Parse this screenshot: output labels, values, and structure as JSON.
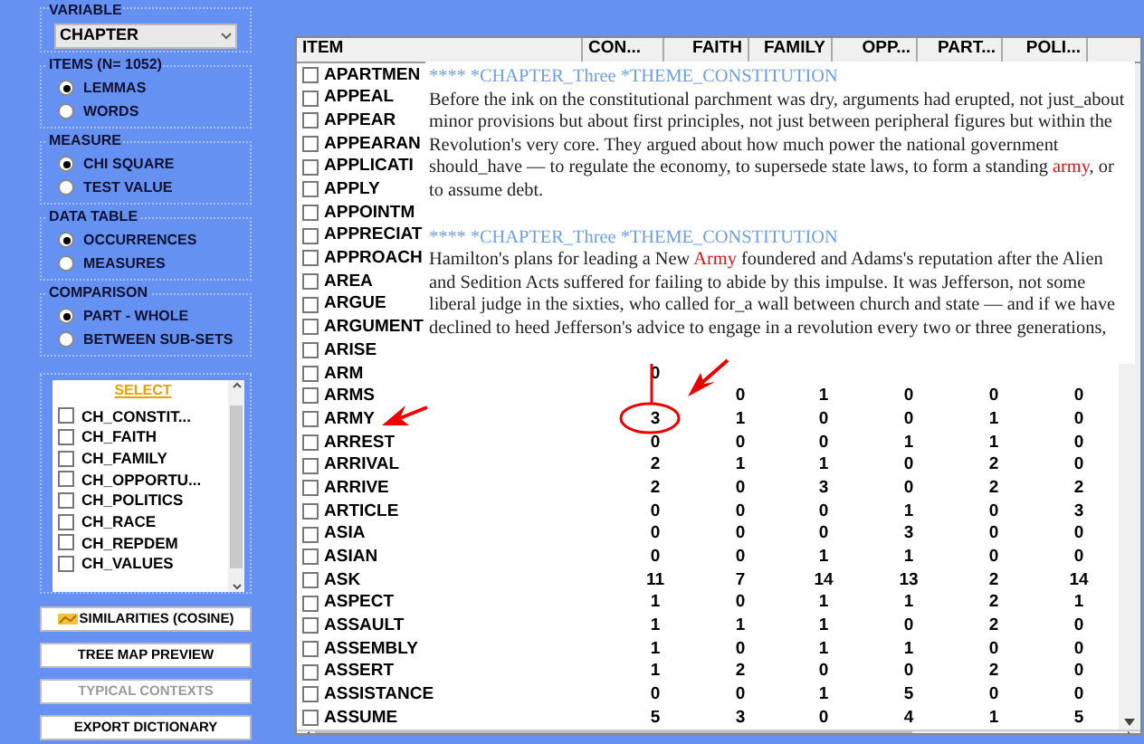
{
  "variable": {
    "label": "VARIABLE",
    "value": "CHAPTER"
  },
  "option_groups": [
    {
      "title": "ITEMS (N= 1052)",
      "options": [
        {
          "label": "LEMMAS",
          "selected": true
        },
        {
          "label": "WORDS",
          "selected": false
        }
      ]
    },
    {
      "title": "MEASURE",
      "options": [
        {
          "label": "CHI SQUARE",
          "selected": true
        },
        {
          "label": "TEST VALUE",
          "selected": false
        }
      ]
    },
    {
      "title": "DATA TABLE",
      "options": [
        {
          "label": "OCCURRENCES",
          "selected": true
        },
        {
          "label": "MEASURES",
          "selected": false
        }
      ]
    },
    {
      "title": "COMPARISON",
      "options": [
        {
          "label": "PART - WHOLE",
          "selected": true
        },
        {
          "label": "BETWEEN SUB-SETS",
          "selected": false
        }
      ]
    }
  ],
  "select_list": {
    "title": "SELECT",
    "items": [
      {
        "label": "CH_CONSTIT...",
        "checked": false
      },
      {
        "label": "CH_FAITH",
        "checked": false
      },
      {
        "label": "CH_FAMILY",
        "checked": false
      },
      {
        "label": "CH_OPPORTU...",
        "checked": false
      },
      {
        "label": "CH_POLITICS",
        "checked": false
      },
      {
        "label": "CH_RACE",
        "checked": false
      },
      {
        "label": "CH_REPDEM",
        "checked": false
      },
      {
        "label": "CH_VALUES",
        "checked": false
      }
    ]
  },
  "buttons": [
    {
      "label": "SIMILARITIES (COSINE)",
      "disabled": false,
      "icon": true
    },
    {
      "label": "TREE MAP PREVIEW",
      "disabled": false,
      "icon": false
    },
    {
      "label": "TYPICAL CONTEXTS",
      "disabled": true,
      "icon": false
    },
    {
      "label": "EXPORT DICTIONARY",
      "disabled": false,
      "icon": false
    }
  ],
  "table": {
    "columns": [
      "ITEM",
      "CON...",
      "FAITH",
      "FAMILY",
      "OPP...",
      "PART...",
      "POLI..."
    ],
    "rows": [
      {
        "item": "APARTMEN",
        "checked": false,
        "values": []
      },
      {
        "item": "APPEAL",
        "checked": false,
        "values": []
      },
      {
        "item": "APPEAR",
        "checked": false,
        "values": []
      },
      {
        "item": "APPEARAN",
        "checked": false,
        "values": []
      },
      {
        "item": "APPLICATI",
        "checked": false,
        "values": []
      },
      {
        "item": "APPLY",
        "checked": false,
        "values": []
      },
      {
        "item": "APPOINTM",
        "checked": false,
        "values": []
      },
      {
        "item": "APPRECIAT",
        "checked": false,
        "values": []
      },
      {
        "item": "APPROACH",
        "checked": false,
        "values": []
      },
      {
        "item": "AREA",
        "checked": false,
        "values": []
      },
      {
        "item": "ARGUE",
        "checked": false,
        "values": []
      },
      {
        "item": "ARGUMENT",
        "checked": false,
        "values": []
      },
      {
        "item": "ARISE",
        "checked": false,
        "values": []
      },
      {
        "item": "ARM",
        "checked": false,
        "values": [
          "0"
        ]
      },
      {
        "item": "ARMS",
        "checked": false,
        "first_cell_covered": true,
        "values": [
          "0",
          "1",
          "0",
          "0",
          "0"
        ]
      },
      {
        "item": "ARMY",
        "checked": false,
        "values": [
          "3",
          "1",
          "0",
          "0",
          "1",
          "0"
        ]
      },
      {
        "item": "ARREST",
        "checked": false,
        "values": [
          "0",
          "0",
          "0",
          "1",
          "1",
          "0"
        ]
      },
      {
        "item": "ARRIVAL",
        "checked": false,
        "values": [
          "2",
          "1",
          "1",
          "0",
          "2",
          "0"
        ]
      },
      {
        "item": "ARRIVE",
        "checked": false,
        "values": [
          "2",
          "0",
          "3",
          "0",
          "2",
          "2"
        ]
      },
      {
        "item": "ARTICLE",
        "checked": false,
        "values": [
          "0",
          "0",
          "0",
          "1",
          "0",
          "3"
        ]
      },
      {
        "item": "ASIA",
        "checked": false,
        "values": [
          "0",
          "0",
          "0",
          "3",
          "0",
          "0"
        ]
      },
      {
        "item": "ASIAN",
        "checked": false,
        "values": [
          "0",
          "0",
          "1",
          "1",
          "0",
          "0"
        ]
      },
      {
        "item": "ASK",
        "checked": false,
        "values": [
          "11",
          "7",
          "14",
          "13",
          "2",
          "14"
        ]
      },
      {
        "item": "ASPECT",
        "checked": false,
        "values": [
          "1",
          "0",
          "1",
          "1",
          "2",
          "1"
        ]
      },
      {
        "item": "ASSAULT",
        "checked": false,
        "values": [
          "1",
          "1",
          "1",
          "0",
          "2",
          "0"
        ]
      },
      {
        "item": "ASSEMBLY",
        "checked": false,
        "values": [
          "1",
          "0",
          "1",
          "1",
          "0",
          "0"
        ]
      },
      {
        "item": "ASSERT",
        "checked": false,
        "values": [
          "1",
          "2",
          "0",
          "0",
          "2",
          "0"
        ]
      },
      {
        "item": "ASSISTANCE",
        "checked": false,
        "values": [
          "0",
          "0",
          "1",
          "5",
          "0",
          "0"
        ]
      },
      {
        "item": "ASSUME",
        "checked": false,
        "values": [
          "5",
          "3",
          "0",
          "4",
          "1",
          "5"
        ]
      }
    ]
  },
  "context_popup": {
    "passages": [
      {
        "heading": "**** *CHAPTER_Three *THEME_CONSTITUTION",
        "text": "Before the ink on the constitutional parchment was dry, arguments had erupted, not just_about minor provisions but about first principles, not just between peripheral figures but within the Revolution's very core. They argued about how much power the national government should_have — to regulate the economy, to supersede state laws, to form a standing **army**, or to assume debt."
      },
      {
        "heading": "**** *CHAPTER_Three *THEME_CONSTITUTION",
        "text": "Hamilton's plans for leading a New **Army** foundered and Adams's reputation after the Alien and Sedition Acts suffered for failing to abide by this impulse. It was Jefferson, not some liberal judge in the sixties, who called for_a wall between church and state — and if we have declined to heed Jefferson's advice to engage in a revolution every two or three generations,"
      }
    ]
  }
}
